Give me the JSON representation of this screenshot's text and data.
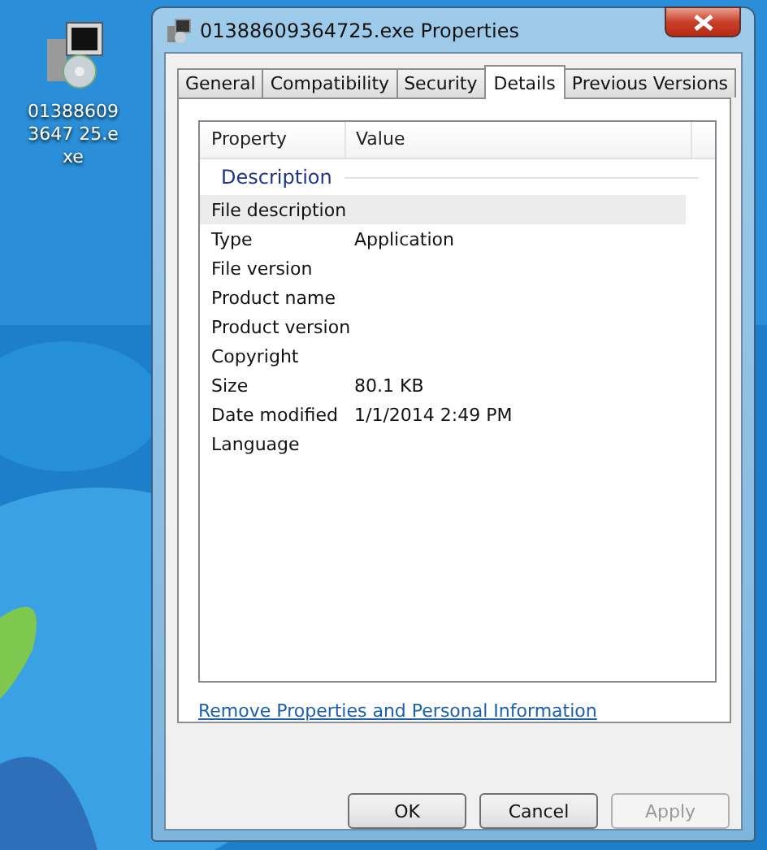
{
  "desktop_icon": {
    "label": "013886093647 25.exe"
  },
  "window": {
    "title": "01388609364725.exe Properties"
  },
  "tabs": [
    {
      "label": "General",
      "selected": false
    },
    {
      "label": "Compatibility",
      "selected": false
    },
    {
      "label": "Security",
      "selected": false
    },
    {
      "label": "Details",
      "selected": true
    },
    {
      "label": "Previous Versions",
      "selected": false
    }
  ],
  "table": {
    "columns": [
      "Property",
      "Value"
    ],
    "section": "Description",
    "rows": [
      {
        "property": "File description",
        "value": "",
        "selected": true
      },
      {
        "property": "Type",
        "value": "Application",
        "selected": false
      },
      {
        "property": "File version",
        "value": "",
        "selected": false
      },
      {
        "property": "Product name",
        "value": "",
        "selected": false
      },
      {
        "property": "Product version",
        "value": "",
        "selected": false
      },
      {
        "property": "Copyright",
        "value": "",
        "selected": false
      },
      {
        "property": "Size",
        "value": "80.1 KB",
        "selected": false
      },
      {
        "property": "Date modified",
        "value": "1/1/2014 2:49 PM",
        "selected": false
      },
      {
        "property": "Language",
        "value": "",
        "selected": false
      }
    ]
  },
  "link": "Remove Properties and Personal Information",
  "buttons": [
    {
      "label": "OK",
      "disabled": false
    },
    {
      "label": "Cancel",
      "disabled": false
    },
    {
      "label": "Apply",
      "disabled": true
    }
  ]
}
